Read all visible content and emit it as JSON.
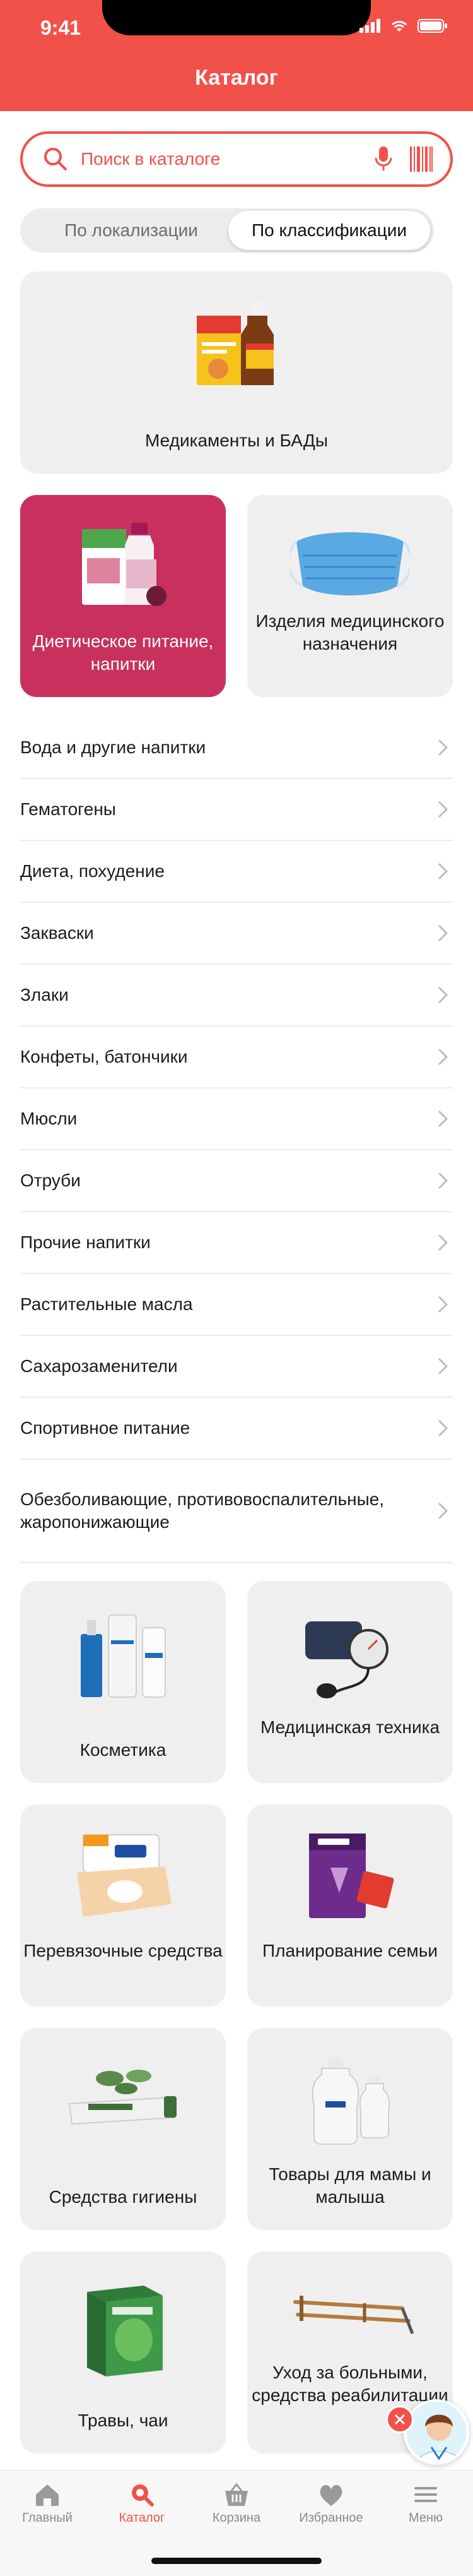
{
  "status_bar": {
    "time": "9:41"
  },
  "header": {
    "title": "Каталог"
  },
  "search": {
    "placeholder": "Поиск в каталоге"
  },
  "segments": {
    "by_localization": "По локализации",
    "by_classification": "По классификации",
    "selected": "По классификации"
  },
  "top_categories": [
    {
      "label": "Медикаменты и БАДы",
      "icon": "medicine-bottle-image"
    },
    {
      "label": "Диетическое питание, напитки",
      "icon": "diet-products-image",
      "selected": true
    },
    {
      "label": "Изделия медицинского назначения",
      "icon": "face-mask-image"
    }
  ],
  "subcategories": [
    "Вода и другие напитки",
    "Гематогены",
    "Диета, похудение",
    "Закваски",
    "Злаки",
    "Конфеты, батончики",
    "Мюсли",
    "Отруби",
    "Прочие напитки",
    "Растительные масла",
    "Сахарозаменители",
    "Спортивное питание",
    "Обезболивающие, противовоспалительные, жаропонижающие"
  ],
  "bottom_categories": [
    {
      "label": "Косметика",
      "icon": "cosmetics-image"
    },
    {
      "label": "Медицинская техника",
      "icon": "blood-pressure-monitor-image"
    },
    {
      "label": "Перевязочные средства",
      "icon": "bandage-image"
    },
    {
      "label": "Планирование семьи",
      "icon": "condoms-image"
    },
    {
      "label": "Средства гигиены",
      "icon": "toothpaste-image"
    },
    {
      "label": "Товары для мамы и малыша",
      "icon": "baby-bottle-image"
    },
    {
      "label": "Травы, чаи",
      "icon": "herbal-tea-image"
    },
    {
      "label": "Уход за больными, средства реабилитации",
      "icon": "crutches-image"
    }
  ],
  "tabbar": [
    {
      "label": "Главный",
      "icon": "home-icon"
    },
    {
      "label": "Каталог",
      "icon": "catalog-search-icon",
      "active": true
    },
    {
      "label": "Корзина",
      "icon": "basket-icon"
    },
    {
      "label": "Избранное",
      "icon": "heart-icon"
    },
    {
      "label": "Меню",
      "icon": "menu-icon"
    }
  ],
  "colors": {
    "accent": "#f2514a",
    "selected_card": "#c8315e",
    "card_bg": "#efefef"
  }
}
